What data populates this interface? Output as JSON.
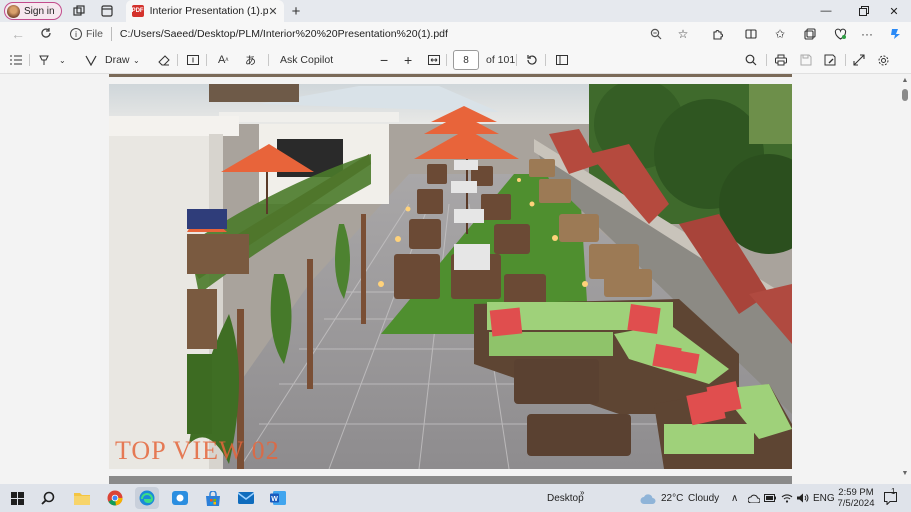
{
  "browser": {
    "signin_label": "Sign in",
    "tab_title": "Interior Presentation (1).pdf",
    "url_scheme_label": "File",
    "url": "C:/Users/Saeed/Desktop/PLM/Interior%20%20Presentation%20(1).pdf"
  },
  "pdf_toolbar": {
    "draw_label": "Draw",
    "ask_copilot_label": "Ask Copilot",
    "current_page": "8",
    "page_count_label": "of 101"
  },
  "page_content": {
    "overlay_title": "TOP VIEW 02"
  },
  "taskbar": {
    "desktop_label": "Desktop",
    "weather_temp": "22°C",
    "weather_desc": "Cloudy",
    "lang": "ENG",
    "time": "2:59 PM",
    "date": "7/5/2024",
    "notification_count": "1"
  },
  "colors": {
    "accent_orange": "#e5663c",
    "umbrella": "#e8643a",
    "cushion_green": "#9fd17a",
    "pillow_red": "#e04e4e",
    "grass": "#4f8f2f"
  }
}
